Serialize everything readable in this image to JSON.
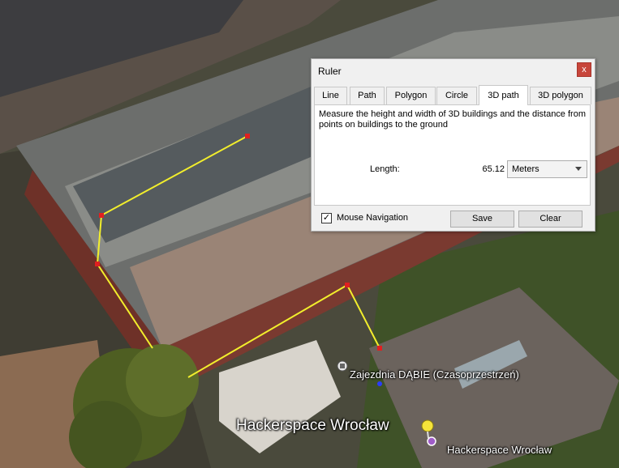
{
  "map": {
    "labels": {
      "zajezdnia": "Zajezdnia DĄBIE (Czasoprzestrzeń)",
      "hackerspace_big": "Hackerspace Wrocław",
      "hackerspace_small": "Hackerspace Wrocław"
    }
  },
  "ruler": {
    "title": "Ruler",
    "close_glyph": "x",
    "tabs": [
      {
        "label": "Line"
      },
      {
        "label": "Path"
      },
      {
        "label": "Polygon"
      },
      {
        "label": "Circle"
      },
      {
        "label": "3D path",
        "active": true
      },
      {
        "label": "3D polygon"
      }
    ],
    "description": "Measure the height and width of 3D buildings and the distance from points on buildings to the ground",
    "length_label": "Length:",
    "length_value": "65.12",
    "unit": "Meters",
    "mouse_navigation": {
      "label": "Mouse Navigation",
      "checked": true,
      "check_glyph": "✓"
    },
    "save_label": "Save",
    "clear_label": "Clear"
  },
  "colors": {
    "measure_line": "#f2ee2c",
    "measure_point": "#e02020",
    "close_button": "#c7463b"
  }
}
